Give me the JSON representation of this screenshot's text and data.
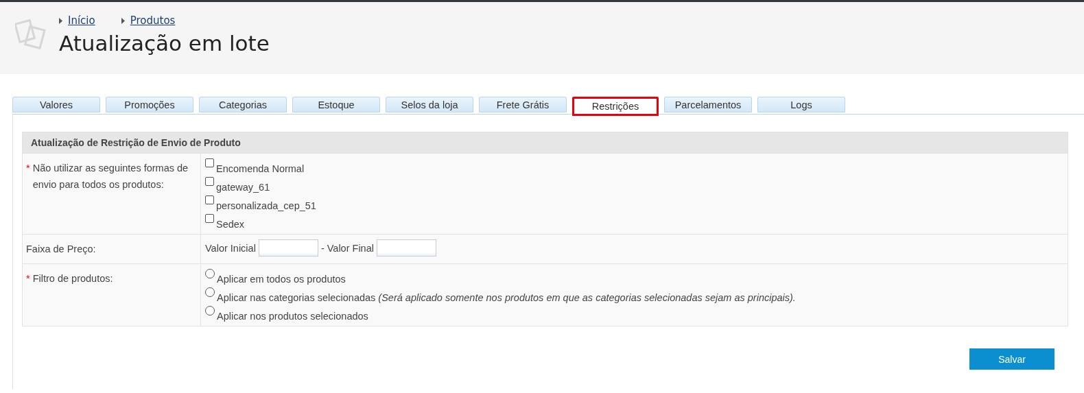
{
  "breadcrumbs": [
    {
      "label": "Início"
    },
    {
      "label": "Produtos"
    }
  ],
  "title": "Atualização em lote",
  "tabs": [
    {
      "label": "Valores",
      "selected": false
    },
    {
      "label": "Promoções",
      "selected": false
    },
    {
      "label": "Categorias",
      "selected": false
    },
    {
      "label": "Estoque",
      "selected": false
    },
    {
      "label": "Selos da loja",
      "selected": false
    },
    {
      "label": "Frete Grátis",
      "selected": false
    },
    {
      "label": "Restrições",
      "selected": true
    },
    {
      "label": "Parcelamentos",
      "selected": false
    },
    {
      "label": "Logs",
      "selected": false
    }
  ],
  "form": {
    "heading": "Atualização de Restrição de Envio de Produto",
    "rows": [
      {
        "kind": "checkboxes",
        "required_mark": "*",
        "label": "Não utilizar as seguintes formas de envio para todos os produtos:",
        "options": [
          {
            "label": "Encomenda Normal",
            "checked": false
          },
          {
            "label": "gateway_61",
            "checked": false
          },
          {
            "label": "personalizada_cep_51",
            "checked": false
          },
          {
            "label": "Sedex",
            "checked": false
          }
        ]
      },
      {
        "kind": "range",
        "label": "Faixa de Preço:",
        "from_label": "Valor Inicial",
        "to_label": "- Valor Final"
      },
      {
        "kind": "radios",
        "required_mark": "*",
        "label": "Filtro de produtos:",
        "options": [
          {
            "label": "Aplicar em todos os produtos",
            "selected": false
          },
          {
            "label": "Aplicar nas categorias selecionadas *(Será aplicado somente nos produtos em que as categorias selecionadas sejam as principais).*",
            "selected": false
          },
          {
            "label": "Aplicar nos produtos selecionados",
            "selected": false
          }
        ]
      }
    ]
  },
  "save_button": "Salvar"
}
